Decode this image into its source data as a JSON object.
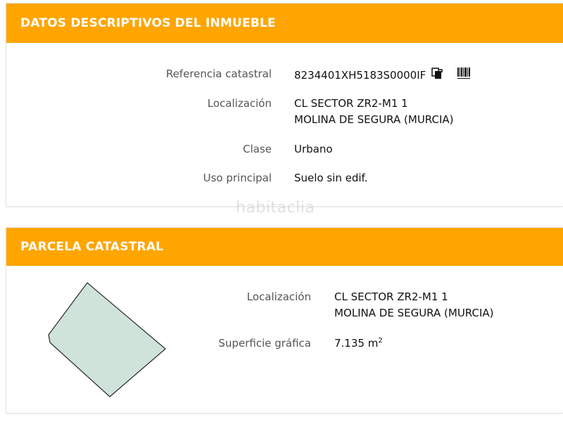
{
  "descriptive": {
    "title": "DATOS DESCRIPTIVOS DEL INMUEBLE",
    "rows": [
      {
        "label": "Referencia catastral",
        "value": "8234401XH5183S0000IF"
      },
      {
        "label": "Localización",
        "value_lines": [
          "CL SECTOR ZR2-M1 1",
          "MOLINA DE SEGURA (MURCIA)"
        ]
      },
      {
        "label": "Clase",
        "value": "Urbano"
      },
      {
        "label": "Uso principal",
        "value": "Suelo sin edif."
      }
    ],
    "icons": [
      "copy-icon",
      "barcode-icon"
    ]
  },
  "parcel": {
    "title": "PARCELA CATASTRAL",
    "rows": [
      {
        "label": "Localización",
        "value_lines": [
          "CL SECTOR ZR2-M1 1",
          "MOLINA DE SEGURA (MURCIA)"
        ]
      },
      {
        "label": "Superficie gráfica",
        "value": "7.135 m",
        "unit_exp": "2"
      }
    ],
    "shape_fill": "#cfe3da",
    "shape_stroke": "#333333"
  },
  "theme": {
    "accent": "#ffa500"
  },
  "watermark": "habitaclia"
}
